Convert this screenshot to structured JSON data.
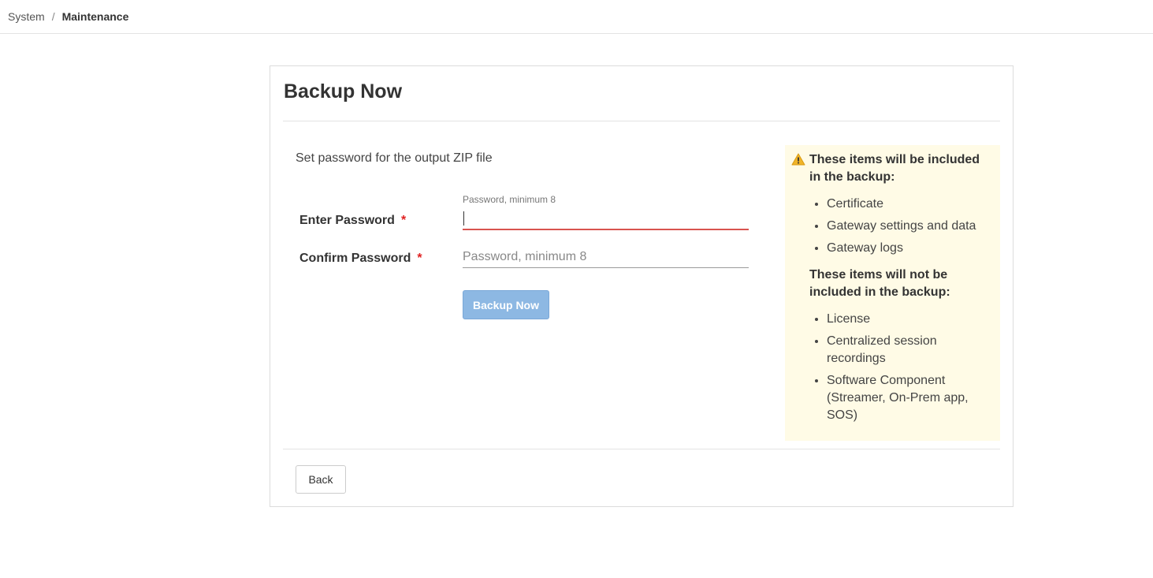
{
  "breadcrumb": {
    "parent": "System",
    "separator": "/",
    "current": "Maintenance"
  },
  "card": {
    "title": "Backup Now",
    "instruction": "Set password for the output ZIP file",
    "enter_password": {
      "label": "Enter Password",
      "required_mark": "*",
      "floating_label": "Password, minimum 8",
      "value": "",
      "placeholder": ""
    },
    "confirm_password": {
      "label": "Confirm Password",
      "required_mark": "*",
      "value": "",
      "placeholder": "Password, minimum 8"
    },
    "backup_button_label": "Backup Now",
    "back_button_label": "Back"
  },
  "info_panel": {
    "icon": "warning-icon",
    "included_heading": "These items will be included in the backup:",
    "included_items": [
      "Certificate",
      "Gateway settings and data",
      "Gateway logs"
    ],
    "excluded_heading": "These items will not be included in the backup:",
    "excluded_items": [
      "License",
      "Centralized session recordings",
      "Software Component (Streamer, On-Prem app, SOS)"
    ]
  },
  "colors": {
    "error_underline": "#d9534f",
    "required_mark": "#e02020",
    "primary_button_disabled": "#8db8e3",
    "info_panel_bg": "#fffbe6",
    "warning_icon": "#f0b429"
  }
}
